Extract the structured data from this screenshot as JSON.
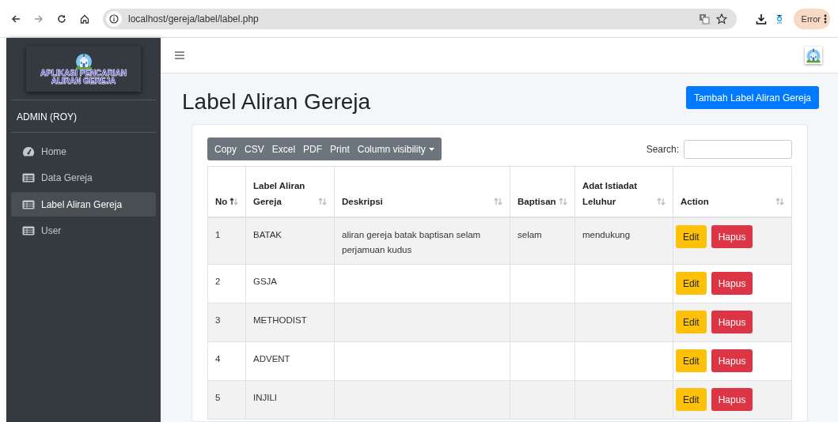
{
  "browser": {
    "url": "localhost/gereja/label/label.php",
    "profile_label": "Error"
  },
  "sidebar": {
    "logo_lines": [
      "APLIKASI PENCARIAN",
      "ALIRAN GEREJA"
    ],
    "user": "ADMIN (ROY)",
    "items": [
      {
        "label": "Home",
        "kind": "dashboard",
        "selected": false
      },
      {
        "label": "Data Gereja",
        "kind": "table",
        "selected": false
      },
      {
        "label": "Label Aliran Gereja",
        "kind": "table",
        "selected": true
      },
      {
        "label": "User",
        "kind": "table",
        "selected": false
      }
    ]
  },
  "page": {
    "title": "Label Aliran Gereja",
    "add_button": "Tambah Label Aliran Gereja"
  },
  "table": {
    "export_buttons": [
      {
        "label": "Copy",
        "kind": "plain"
      },
      {
        "label": "CSV",
        "kind": "plain"
      },
      {
        "label": "Excel",
        "kind": "plain"
      },
      {
        "label": "PDF",
        "kind": "plain"
      },
      {
        "label": "Print",
        "kind": "plain"
      },
      {
        "label": "Column visibility",
        "kind": "dropdown"
      }
    ],
    "search_label": "Search:",
    "columns": [
      {
        "label": "No",
        "sorted_ascending": true
      },
      {
        "label": "Label Aliran Gereja",
        "sorted_ascending": false
      },
      {
        "label": "Deskripsi",
        "sorted_ascending": false
      },
      {
        "label": "Baptisan",
        "sorted_ascending": false
      },
      {
        "label": "Adat Istiadat Leluhur",
        "sorted_ascending": false
      },
      {
        "label": "Action",
        "sorted_ascending": false
      }
    ],
    "rows": [
      {
        "no": "1",
        "label": "BATAK",
        "deskripsi": "aliran gereja batak baptisan selam perjamuan kudus",
        "baptisan": "selam",
        "adat": "mendukung",
        "actions": [
          "Edit",
          "Hapus"
        ]
      },
      {
        "no": "2",
        "label": "GSJA",
        "actions": [
          "Edit",
          "Hapus"
        ]
      },
      {
        "no": "3",
        "label": "METHODIST",
        "actions": [
          "Edit",
          "Hapus"
        ]
      },
      {
        "no": "4",
        "label": "ADVENT",
        "actions": [
          "Edit",
          "Hapus"
        ]
      },
      {
        "no": "5",
        "label": "INJILI",
        "actions": [
          "Edit",
          "Hapus"
        ]
      }
    ]
  }
}
